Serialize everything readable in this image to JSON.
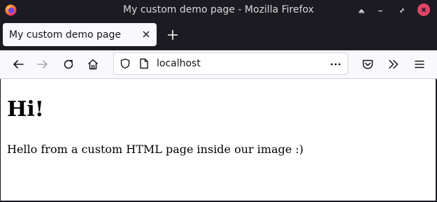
{
  "window": {
    "title": "My custom demo page - Mozilla Firefox",
    "app_icon": "firefox-icon",
    "controls": [
      "keep-above-icon",
      "minimize-icon",
      "maximize-icon",
      "close-icon"
    ]
  },
  "tabs": [
    {
      "label": "My custom demo page",
      "active": true
    }
  ],
  "navbar": {
    "url": "localhost",
    "buttons": [
      "back-icon",
      "forward-icon",
      "reload-icon",
      "home-icon",
      "pocket-icon",
      "overflow-icon",
      "menu-icon"
    ]
  },
  "page": {
    "heading": "Hi!",
    "paragraph": "Hello from a custom HTML page inside our image :)"
  },
  "colors": {
    "titlebar_bg": "#1c1b22",
    "toolbar_bg": "#f9f9fb",
    "close_button": "#e04468",
    "content_bg": "#ffffff"
  }
}
